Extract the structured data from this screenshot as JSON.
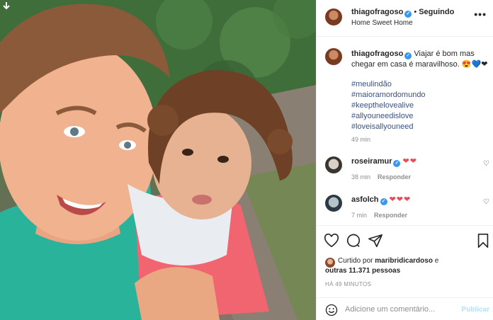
{
  "post": {
    "username": "thiagofragoso",
    "follow_separator": "•",
    "follow_status": "Seguindo",
    "location": "Home Sweet Home",
    "more_icon": "more-options-icon"
  },
  "caption": {
    "username": "thiagofragoso",
    "text": "Viajar é bom mas chegar em casa é maravilhoso. 😍💙❤",
    "hashtags": [
      "#meulindão",
      "#maioramordomundo",
      "#keepthelovealive",
      "#allyouneedislove",
      "#loveisallyouneed"
    ],
    "time": "49 min"
  },
  "comments": [
    {
      "username": "roseiramur",
      "hearts": "❤❤",
      "time": "38 min",
      "reply": "Responder"
    },
    {
      "username": "asfolch",
      "hearts": "❤❤❤",
      "time": "7 min",
      "reply": "Responder"
    }
  ],
  "likes": {
    "prefix": "Curtido por",
    "liker": "maribridicardoso",
    "conj": "e",
    "others": "outras 11.371 pessoas"
  },
  "post_date": "HÁ 49 MINUTOS",
  "add_comment": {
    "placeholder": "Adicione um comentário...",
    "post_label": "Publicar"
  },
  "colors": {
    "accent_blue": "#3897f0",
    "hashtag": "#385185",
    "heart": "#ed4956",
    "muted": "#8e8e8e"
  }
}
